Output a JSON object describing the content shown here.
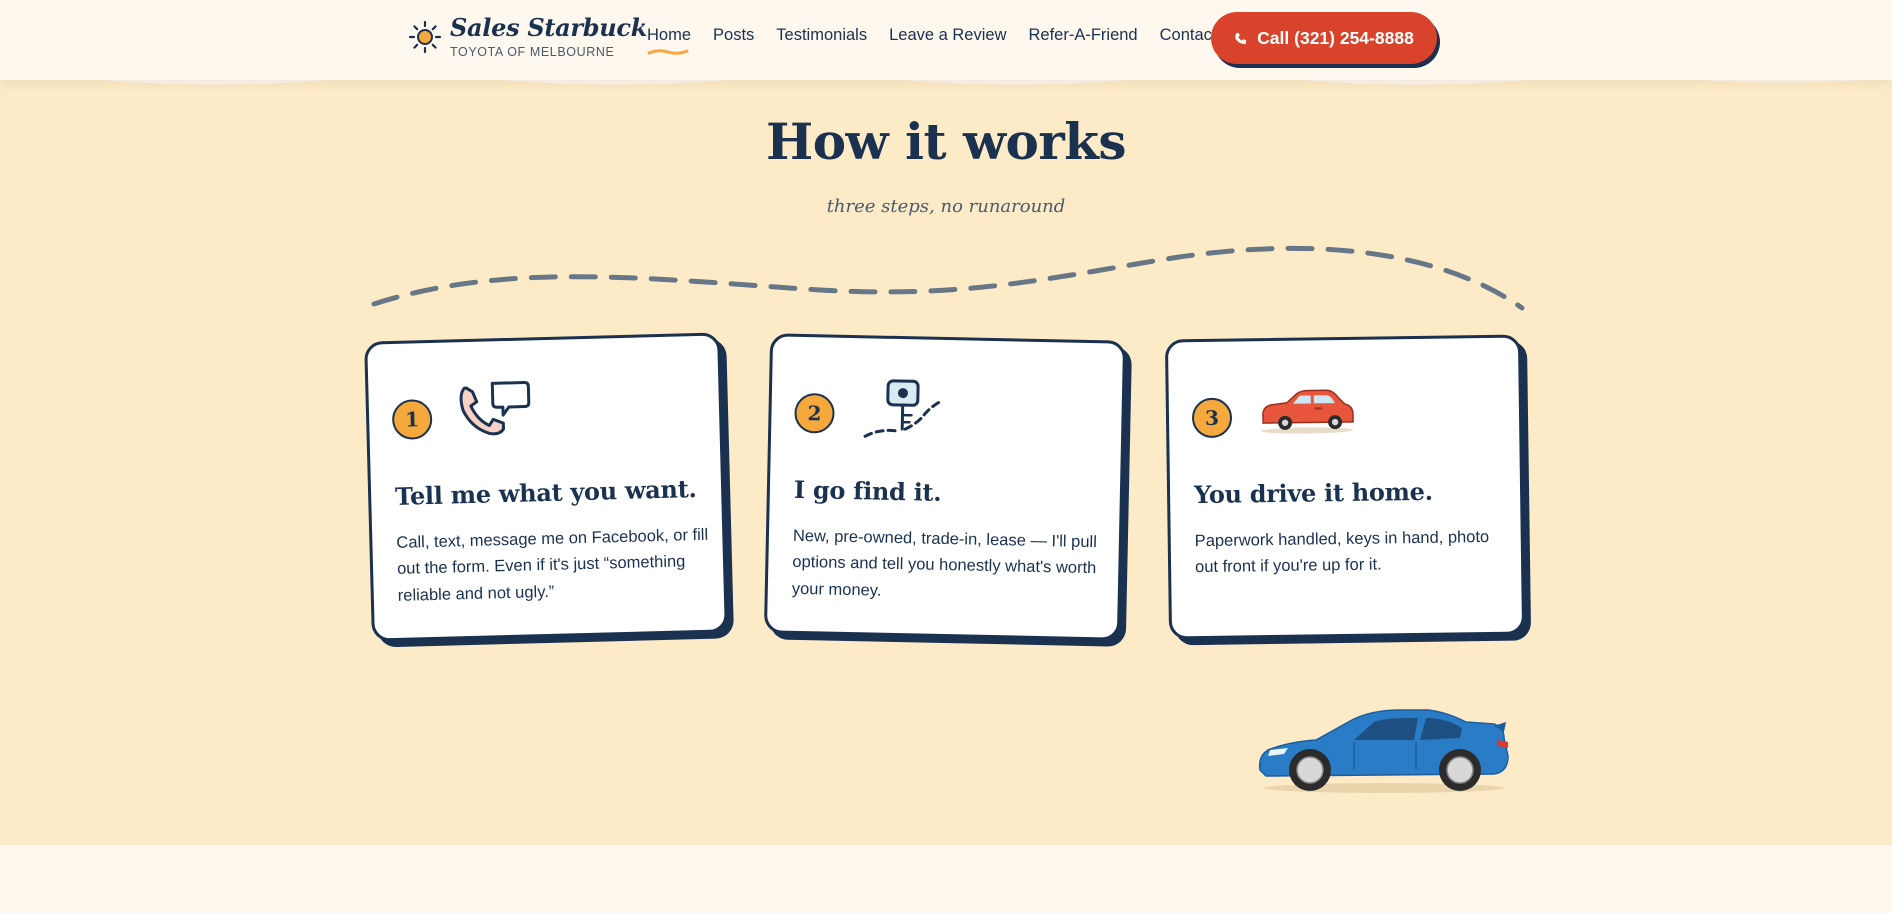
{
  "brand": {
    "name": "Sales Starbuck",
    "subtitle": "TOYOTA OF MELBOURNE",
    "logo_icon": "sun-icon"
  },
  "nav": {
    "items": [
      {
        "label": "Home",
        "active": true
      },
      {
        "label": "Posts"
      },
      {
        "label": "Testimonials"
      },
      {
        "label": "Leave a Review"
      },
      {
        "label": "Refer-A-Friend"
      },
      {
        "label": "Contact"
      }
    ],
    "call_button": {
      "label": "Call (321) 254-8888",
      "icon": "phone-icon"
    }
  },
  "section": {
    "title": "How it works",
    "subtitle": "three steps, no runaround"
  },
  "steps": [
    {
      "number": "1",
      "icon": "phone-chat-icon",
      "title": "Tell me what you want.",
      "body": "Call, text, message me on Facebook, or fill out the form. Even if it's just “something reliable and not ugly.”"
    },
    {
      "number": "2",
      "icon": "location-pin-route-icon",
      "title": "I go find it.",
      "body": "New, pre-owned, trade-in, lease — I'll pull options and tell you honestly what's worth your money."
    },
    {
      "number": "3",
      "icon": "red-car-icon",
      "title": "You drive it home.",
      "body": "Paperwork handled, keys in hand, photo out front if you're up for it."
    }
  ],
  "colors": {
    "navy": "#1a3150",
    "orange": "#f5a83c",
    "red": "#d9432b",
    "cream": "#fdebc8",
    "header_bg": "#fef8ef",
    "blue_car": "#2a7cc7"
  }
}
